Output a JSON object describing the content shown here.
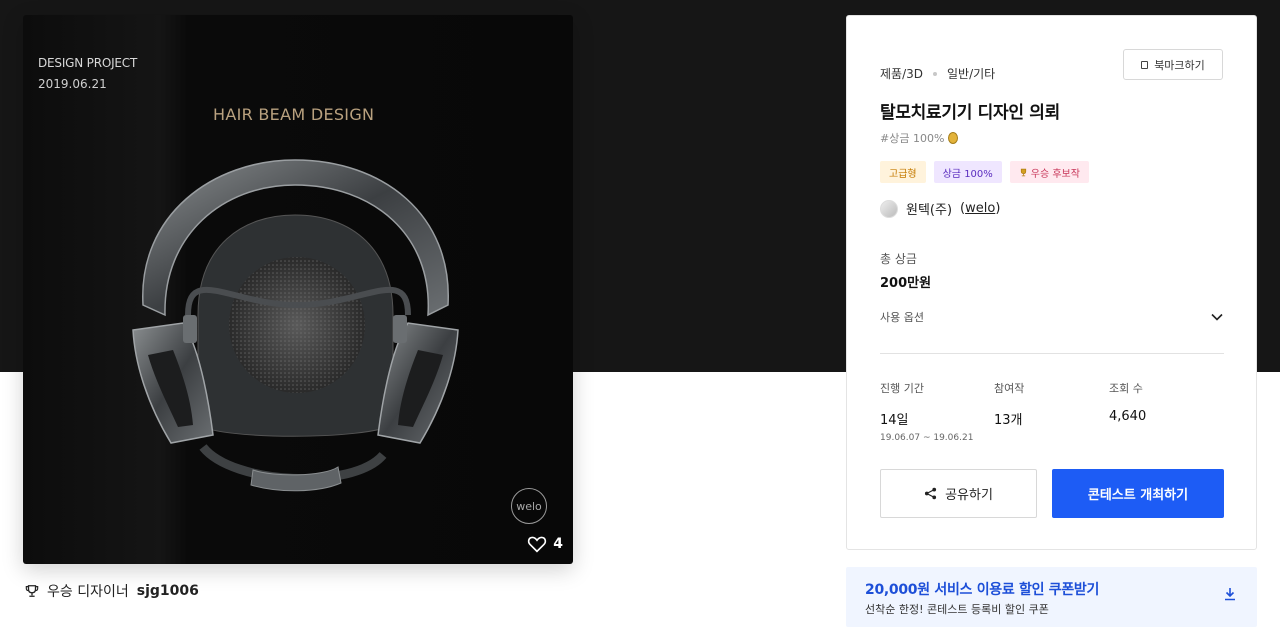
{
  "artwork": {
    "project_label": "DESIGN PROJECT",
    "date": "2019.06.21",
    "title": "HAIR BEAM DESIGN",
    "badge": "welo",
    "like_count": "4"
  },
  "winner": {
    "label": "우승 디자이너",
    "name": "sjg1006"
  },
  "contest": {
    "category": "제품/3D",
    "subcategory": "일반/기타",
    "bookmark_label": "북마크하기",
    "title": "탈모치료기기 디자인 의뢰",
    "hashtag": "#상금 100%",
    "tags": [
      {
        "label": "고급형"
      },
      {
        "label": "상금 100%"
      },
      {
        "label": "우승 후보작"
      }
    ],
    "company": "원텍(주)",
    "company_handle": "welo",
    "total_prize_label": "총 상금",
    "total_prize_value": "200만원",
    "usage_label": "사용 옵션",
    "stats": {
      "period_label": "진행 기간",
      "period_value": "14일",
      "period_range": "19.06.07 ~ 19.06.21",
      "participants_label": "참여작",
      "participants_value": "13개",
      "views_label": "조회 수",
      "views_value": "4,640"
    },
    "share_label": "공유하기",
    "host_label": "콘테스트 개최하기"
  },
  "coupon": {
    "title": "20,000원 서비스 이용료 할인 쿠폰받기",
    "subtitle": "선착순 한정! 콘테스트 등록비 할인 쿠폰"
  },
  "colors": {
    "accent": "#1d5cf5",
    "hero_bg": "#161616",
    "coupon_bg": "#f0f5ff"
  }
}
